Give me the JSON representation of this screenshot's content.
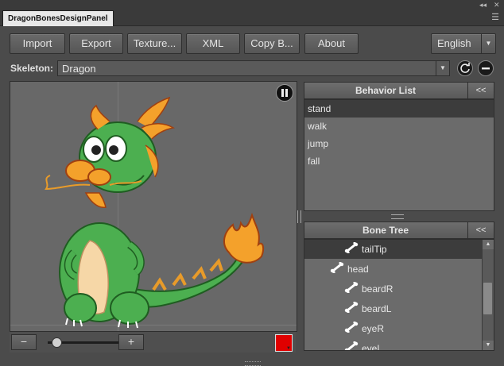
{
  "window": {
    "tab_title": "DragonBonesDesignPanel",
    "collapse_glyph": "◂◂",
    "close_glyph": "✕",
    "menu_glyph": "☰"
  },
  "toolbar": {
    "import_label": "Import",
    "export_label": "Export",
    "texture_label": "Texture...",
    "xml_label": "XML",
    "copy_label": "Copy B...",
    "about_label": "About",
    "language_value": "English"
  },
  "skeleton": {
    "label": "Skeleton:",
    "value": "Dragon"
  },
  "stage": {
    "zoom_out_label": "−",
    "zoom_in_label": "+",
    "zoom_level": 0.1,
    "background_color": "#e00000"
  },
  "behavior_list": {
    "title": "Behavior List",
    "collapse_label": "<<",
    "items": [
      "stand",
      "walk",
      "jump",
      "fall"
    ],
    "selected_index": 0
  },
  "bone_tree": {
    "title": "Bone Tree",
    "collapse_label": "<<",
    "items": [
      {
        "label": "tailTip",
        "depth": 2,
        "selected": true
      },
      {
        "label": "head",
        "depth": 1,
        "selected": false
      },
      {
        "label": "beardR",
        "depth": 2,
        "selected": false
      },
      {
        "label": "beardL",
        "depth": 2,
        "selected": false
      },
      {
        "label": "eyeR",
        "depth": 2,
        "selected": false
      },
      {
        "label": "eyeL",
        "depth": 2,
        "selected": false
      }
    ]
  },
  "icons": {
    "refresh": "refresh-icon",
    "remove": "minus-circle-icon",
    "pause": "pause-icon",
    "bone": "bone-icon"
  }
}
